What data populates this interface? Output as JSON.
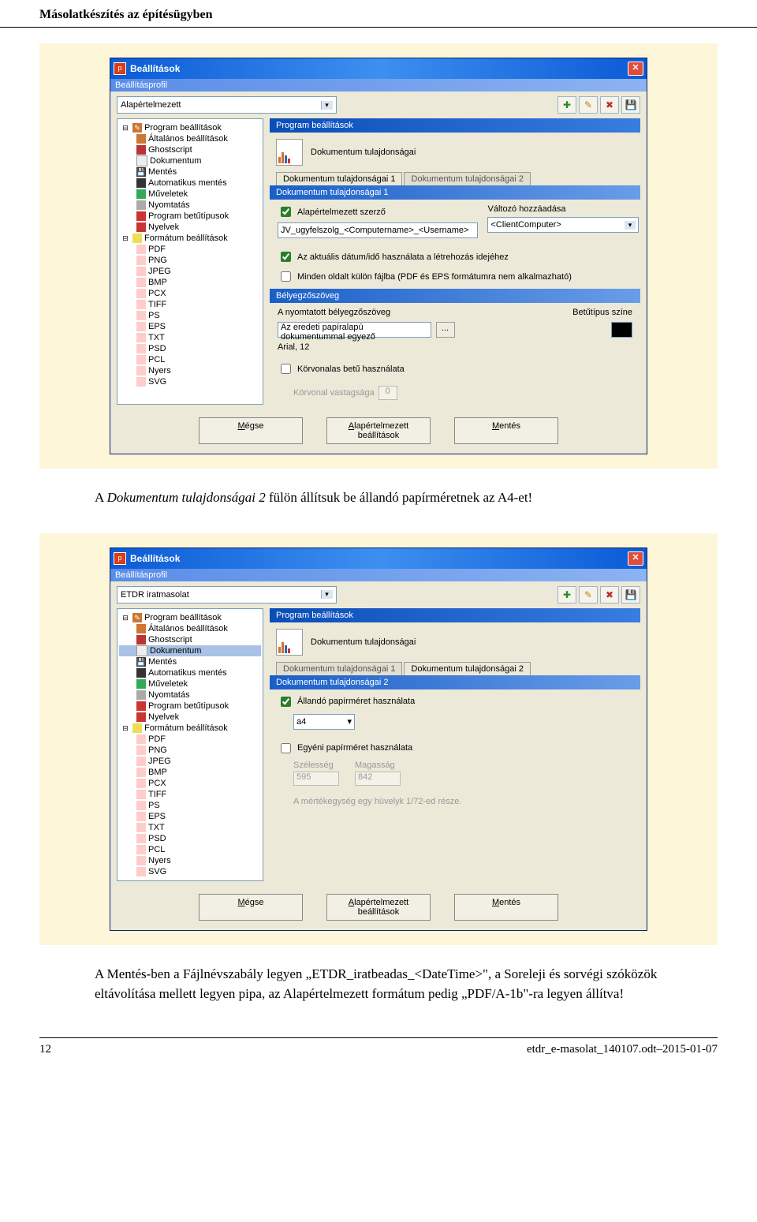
{
  "doc_header": "Másolatkészítés az építésügyben",
  "screenshots": [
    {
      "window_title": "Beállítások",
      "subheader": "Beállításprofil",
      "profile_value": "Alapértelmezett",
      "toolbar_icons": [
        "add-icon",
        "edit-icon",
        "delete-icon",
        "save-icon"
      ],
      "tree": {
        "root1": "Program beállítások",
        "children1": [
          "Általános beállítások",
          "Ghostscript",
          "Dokumentum",
          "Mentés",
          "Automatikus mentés",
          "Műveletek",
          "Nyomtatás",
          "Program betűtípusok",
          "Nyelvek"
        ],
        "root2": "Formátum beállítások",
        "children2": [
          "PDF",
          "PNG",
          "JPEG",
          "BMP",
          "PCX",
          "TIFF",
          "PS",
          "EPS",
          "TXT",
          "PSD",
          "PCL",
          "Nyers",
          "SVG"
        ]
      },
      "panel_header": "Program beállítások",
      "panel_title": "Dokumentum tulajdonságai",
      "tab1": "Dokumentum tulajdonságai 1",
      "tab2": "Dokumentum tulajdonságai 2",
      "section1_header": "Dokumentum tulajdonságai 1",
      "chk_default_author": "Alapértelmezett szerző",
      "author_value": "JV_ugyfelszolg_<Computername>_<Username>",
      "var_add_label": "Változó hozzáadása",
      "var_add_value": "<ClientComputer>",
      "chk_date": "Az aktuális dátum/idő használata a létrehozás idejéhez",
      "chk_pages": "Minden oldalt külön fájlba (PDF és EPS formátumra nem alkalmazható)",
      "section2_header": "Bélyegzőszöveg",
      "stamp_label": "A nyomtatott bélyegzőszöveg",
      "stamp_value": "Az eredeti papíralapú dokumentummal egyező",
      "font_label": "Betűtípus színe",
      "font_info": "Arial, 12",
      "chk_outline": "Körvonalas betű használata",
      "outline_thickness_label": "Körvonal vastagsága",
      "outline_thickness_value": "0",
      "btn_cancel": "Mégse",
      "btn_defaults": "Alapértelmezett beállítások",
      "btn_save": "Mentés"
    },
    {
      "window_title": "Beállítások",
      "subheader": "Beállításprofil",
      "profile_value": "ETDR iratmasolat",
      "panel_header": "Program beállítások",
      "panel_title": "Dokumentum tulajdonságai",
      "tab1": "Dokumentum tulajdonságai 1",
      "tab2": "Dokumentum tulajdonságai 2",
      "section_header": "Dokumentum tulajdonságai 2",
      "chk_fixed_paper": "Állandó papírméret használata",
      "paper_value": "a4",
      "chk_custom_paper": "Egyéni papírméret használata",
      "width_label": "Szélesség",
      "width_value": "595",
      "height_label": "Magasság",
      "height_value": "842",
      "unit_note": "A mértékegység egy hüvelyk 1/72-ed része.",
      "btn_cancel": "Mégse",
      "btn_defaults": "Alapértelmezett beállítások",
      "btn_save": "Mentés",
      "selected_tree": "Dokumentum"
    }
  ],
  "para1_pre": "A ",
  "para1_italic": "Dokumentum tulajdonságai 2",
  "para1_post": " fülön állítsuk be állandó papírméretnek az A4-et!",
  "para2": "A Mentés-ben a Fájlnévszabály legyen „ETDR_iratbeadas_<DateTime>\", a Soreleji és sorvégi szóközök eltávolítása mellett legyen pipa, az Alapértelmezett formátum pedig „PDF/A-1b\"-ra legyen állítva!",
  "footer_page": "12",
  "footer_file": "etdr_e-masolat_140107.odt–2015-01-07"
}
